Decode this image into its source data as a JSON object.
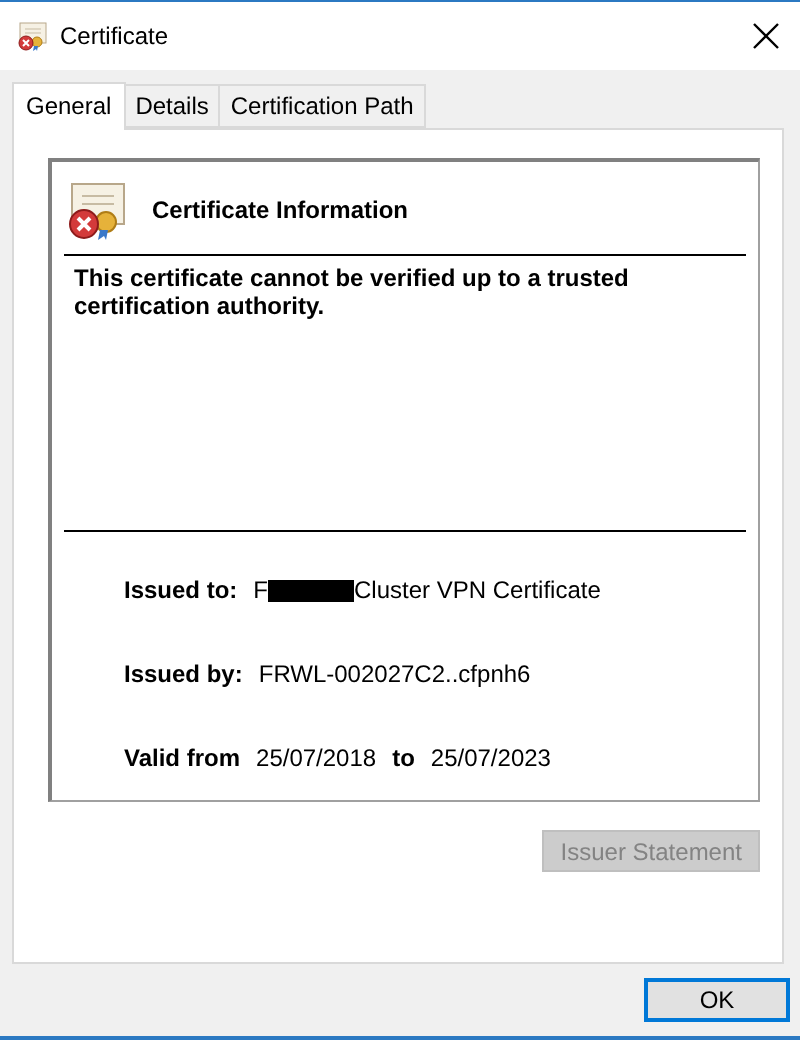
{
  "window": {
    "title": "Certificate"
  },
  "tabs": [
    {
      "label": "General",
      "selected": true
    },
    {
      "label": "Details",
      "selected": false
    },
    {
      "label": "Certification Path",
      "selected": false
    }
  ],
  "info": {
    "heading": "Certificate Information",
    "message": "This certificate cannot be verified up to a trusted certification authority.",
    "valid": false
  },
  "fields": [
    {
      "kind": "redacted",
      "label": "Issued to:",
      "prefix": "F",
      "value": "Cluster VPN Certificate"
    },
    {
      "kind": "plain",
      "label": "Issued by:",
      "value": "FRWL-002027C2..cfpnh6"
    },
    {
      "kind": "range",
      "label": "Valid from",
      "from": "25/07/2018",
      "joiner": "to",
      "to": "25/07/2023"
    }
  ],
  "issuer_button": {
    "label": "Issuer Statement",
    "disabled": true
  },
  "ok_button": {
    "label": "OK"
  }
}
